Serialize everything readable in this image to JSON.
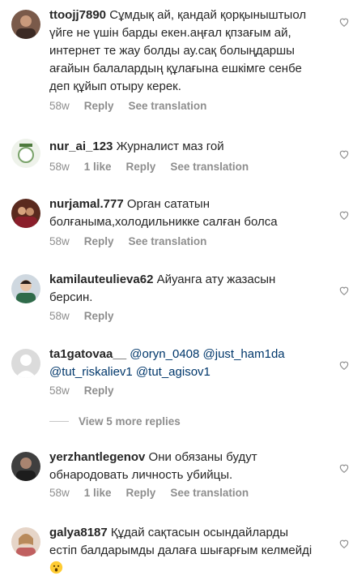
{
  "comments": [
    {
      "user": "ttoojj7890",
      "text": "Сұмдық ай, қандай қорқыныштыол үйге не үшін барды екен.аңғал қпзағым ай, интернет те жау болды ау.сақ болыңдаршы ағайын балалардың құлағына ешкімге сенбе деп құйып отыру керек.",
      "time": "58w",
      "likes": "",
      "reply": "Reply",
      "translate": "See translation"
    },
    {
      "user": "nur_ai_123",
      "text": "Журналист маз гой",
      "time": "58w",
      "likes": "1 like",
      "reply": "Reply",
      "translate": "See translation"
    },
    {
      "user": "nurjamal.777",
      "text": "Орган сататын болғаныма,холодильникке салған болса",
      "time": "58w",
      "likes": "",
      "reply": "Reply",
      "translate": "See translation"
    },
    {
      "user": "kamilauteulieva62",
      "text": "Айуанга ату жазасын берсин.",
      "time": "58w",
      "likes": "",
      "reply": "Reply",
      "translate": ""
    },
    {
      "user": "ta1gatovaa__",
      "mentions": "@oryn_0408 @just_ham1da @tut_riskaliev1 @tut_agisov1",
      "time": "58w",
      "likes": "",
      "reply": "Reply",
      "translate": ""
    },
    {
      "user": "yerzhantlegenov",
      "text": "Они обязаны будут обнародовать личность убийцы.",
      "time": "58w",
      "likes": "1 like",
      "reply": "Reply",
      "translate": "See translation"
    },
    {
      "user": "galya8187",
      "text": "Құдай сақтасын осындайларды естіп балдарымды далаға шығарғым келмейді",
      "time": "",
      "likes": "",
      "reply": "",
      "translate": ""
    }
  ],
  "view_more": "View 5 more replies",
  "colors": {
    "text": "#262626",
    "secondary": "#8e8e8e",
    "mention": "#00376b"
  },
  "icons": {
    "like": "heart-outline-icon",
    "emoji": "hushed-face-emoji"
  }
}
